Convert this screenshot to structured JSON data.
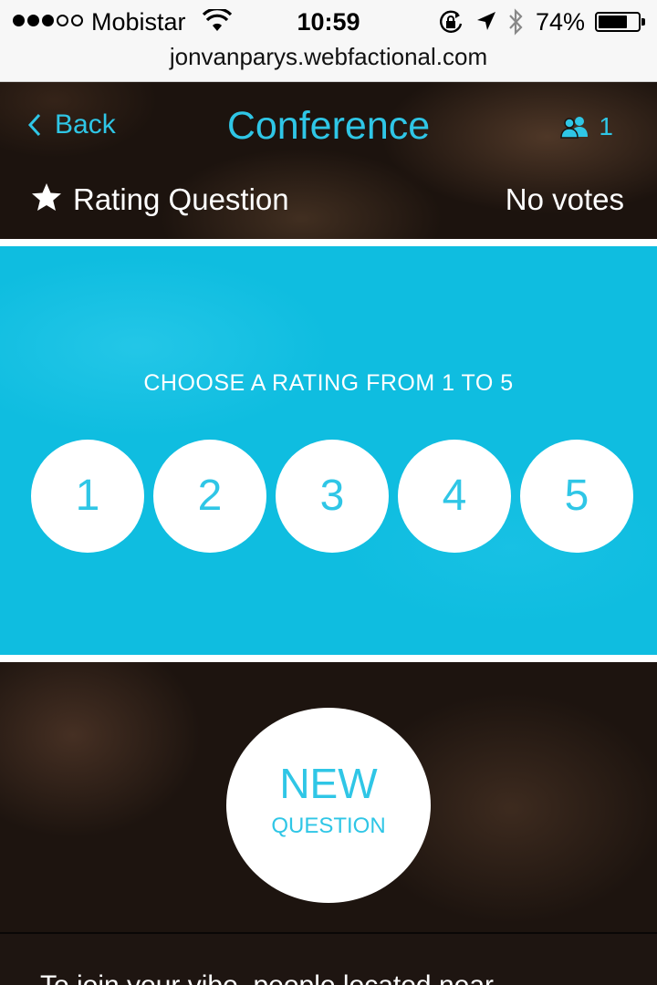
{
  "status_bar": {
    "carrier": "Mobistar",
    "time": "10:59",
    "battery_percent": "74%",
    "battery_level": 0.74,
    "signal_bars_filled": 3,
    "signal_bars_total": 5
  },
  "url_bar": {
    "url": "jonvanparys.webfactional.com"
  },
  "header": {
    "back_label": "Back",
    "title": "Conference",
    "participants_count": "1"
  },
  "question": {
    "title": "Rating Question",
    "votes": "No votes"
  },
  "rating": {
    "prompt": "CHOOSE A RATING FROM 1 TO 5",
    "options": [
      "1",
      "2",
      "3",
      "4",
      "5"
    ]
  },
  "new_question": {
    "line1": "NEW",
    "line2": "QUESTION"
  },
  "info": {
    "text": "To join your vibe, people located near"
  },
  "colors": {
    "accent": "#2fc6e6",
    "panel": "#0fbde0",
    "dark": "#1c130e"
  },
  "icons": {
    "wifi": "wifi-icon",
    "rotation_lock": "rotation-lock-icon",
    "location": "location-arrow-icon",
    "bluetooth": "bluetooth-icon",
    "battery": "battery-icon",
    "back": "chevron-left-icon",
    "users": "users-icon",
    "star": "star-icon"
  }
}
